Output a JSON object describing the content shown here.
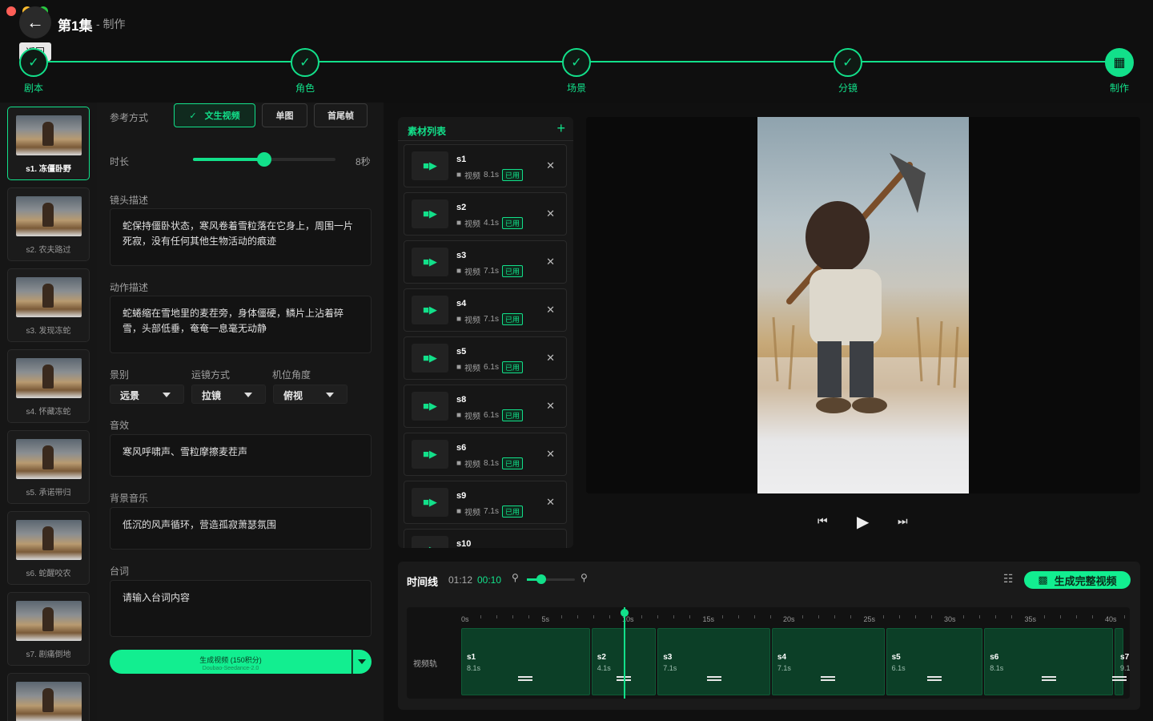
{
  "header": {
    "title": "第1集",
    "subtitle": "- 制作",
    "back_tooltip": "返回"
  },
  "steps": [
    {
      "label": "剧本"
    },
    {
      "label": "角色"
    },
    {
      "label": "场景"
    },
    {
      "label": "分镜"
    },
    {
      "label": "制作"
    }
  ],
  "shots": [
    {
      "label": "s1. 冻僵卧野"
    },
    {
      "label": "s2. 农夫路过"
    },
    {
      "label": "s3. 发现冻蛇"
    },
    {
      "label": "s4. 怀藏冻蛇"
    },
    {
      "label": "s5. 承诺带归"
    },
    {
      "label": "s6. 蛇醒咬农"
    },
    {
      "label": "s7. 剧痛倒地"
    },
    {
      "label": ""
    }
  ],
  "form": {
    "ref_label": "参考方式",
    "ref_options": [
      "文生视频",
      "单图",
      "首尾帧"
    ],
    "ref_selected": "文生视频",
    "duration_label": "时长",
    "duration_value": "8秒",
    "duration_fraction": 0.5,
    "shot_desc_label": "镜头描述",
    "shot_desc": "蛇保持僵卧状态，寒风卷着雪粒落在它身上，周围一片死寂，没有任何其他生物活动的痕迹",
    "action_desc_label": "动作描述",
    "action_desc": "蛇蜷缩在雪地里的麦茬旁，身体僵硬，鳞片上沾着碎雪，头部低垂，奄奄一息毫无动静",
    "shot_size_label": "景别",
    "shot_size_value": "远景",
    "camera_move_label": "运镜方式",
    "camera_move_value": "拉镜",
    "camera_angle_label": "机位角度",
    "camera_angle_value": "俯视",
    "sfx_label": "音效",
    "sfx_value": "寒风呼啸声、雪粒摩擦麦茬声",
    "bgm_label": "背景音乐",
    "bgm_value": "低沉的风声循环，营造孤寂萧瑟氛围",
    "dialogue_label": "台词",
    "dialogue_placeholder": "请输入台词内容",
    "generate_label": "生成视频 (150积分)",
    "generate_model": "Doubao-Seedance-2.0"
  },
  "materials": {
    "title": "素材列表",
    "add_icon": "plus-icon",
    "type_label": "视频",
    "used_label": "已用",
    "items": [
      {
        "name": "s1",
        "duration": "8.1s"
      },
      {
        "name": "s2",
        "duration": "4.1s"
      },
      {
        "name": "s3",
        "duration": "7.1s"
      },
      {
        "name": "s4",
        "duration": "7.1s"
      },
      {
        "name": "s5",
        "duration": "6.1s"
      },
      {
        "name": "s8",
        "duration": "6.1s"
      },
      {
        "name": "s6",
        "duration": "8.1s"
      },
      {
        "name": "s9",
        "duration": "7.1s"
      },
      {
        "name": "s10",
        "duration": ""
      }
    ]
  },
  "timeline": {
    "title": "时间线",
    "total": "01:12",
    "current": "00:10",
    "zoom_fraction": 0.3,
    "generate_full_label": "生成完整视频",
    "track_label": "视频轨",
    "ticks": [
      "0s",
      "5s",
      "10s",
      "15s",
      "20s",
      "25s",
      "30s",
      "35s",
      "40s"
    ],
    "clips": [
      {
        "name": "s1",
        "duration": "8.1s"
      },
      {
        "name": "s2",
        "duration": "4.1s"
      },
      {
        "name": "s3",
        "duration": "7.1s"
      },
      {
        "name": "s4",
        "duration": "7.1s"
      },
      {
        "name": "s5",
        "duration": "6.1s"
      },
      {
        "name": "s6",
        "duration": "8.1s"
      },
      {
        "name": "s7",
        "duration": "9.1"
      }
    ]
  },
  "colors": {
    "accent": "#12e08a",
    "background": "#0f0f0f"
  }
}
